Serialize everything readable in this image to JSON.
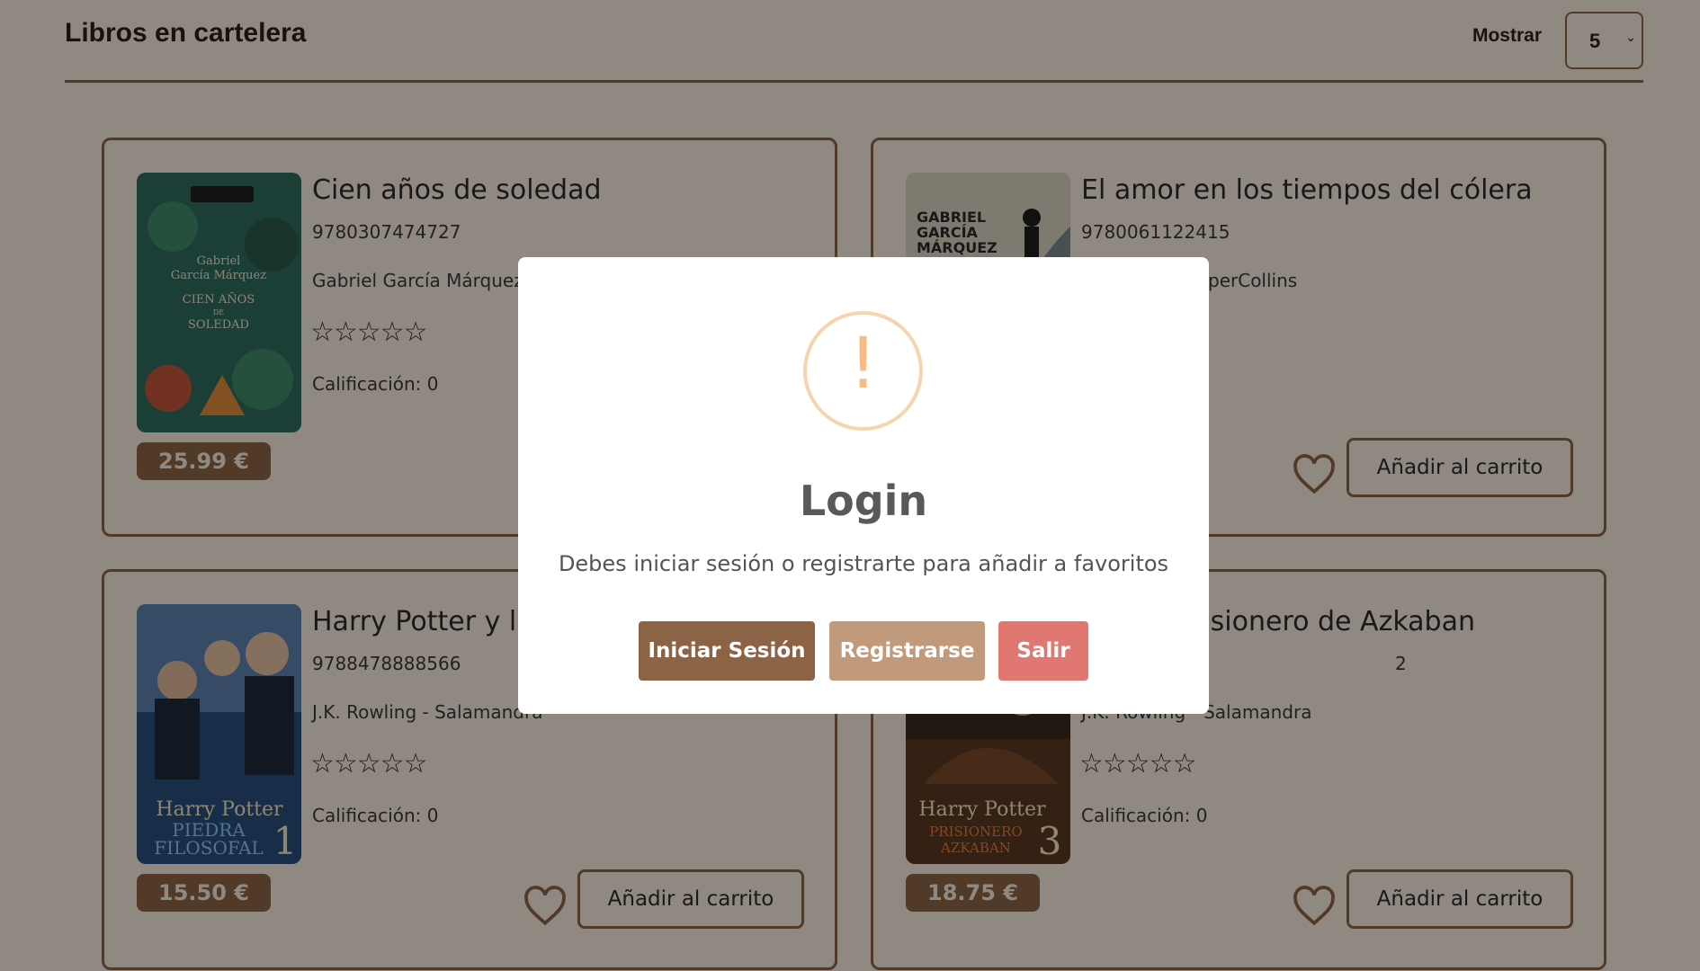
{
  "header": {
    "title": "Libros en cartelera",
    "show_label": "Mostrar",
    "show_value": "5"
  },
  "books": [
    {
      "title": "Cien años de soledad",
      "isbn": "9780307474727",
      "author_publisher": "Gabriel García Márquez -",
      "stars": "☆☆☆☆☆",
      "rating": "Calificación: 0",
      "price": "25.99 €",
      "cart_label": "Añadir al carrito",
      "cover": {
        "bg": "#2f6b5e",
        "line1": "Gabriel",
        "line2": "García Márquez",
        "line3": "CIEN AÑOS",
        "line4": "DE",
        "line5": "SOLEDAD"
      }
    },
    {
      "title": "El amor en los tiempos del cólera",
      "isbn": "9780061122415",
      "author_publisher": "Márquez - HarperCollins",
      "stars": "",
      "rating": "",
      "price": "",
      "cart_label": "Añadir al carrito",
      "cover": {
        "bg": "#d9d2c2",
        "line1": "GABRIEL",
        "line2": "GARCÍA",
        "line3": "MÁRQUEZ"
      }
    },
    {
      "title": "Harry Potter y la",
      "isbn": "9788478888566",
      "author_publisher": "J.K. Rowling - Salamandra",
      "stars": "☆☆☆☆☆",
      "rating": "Calificación: 0",
      "price": "15.50 €",
      "cart_label": "Añadir al carrito",
      "cover": {
        "bg": "#2a4f7a",
        "line1": "Harry Potter",
        "line2": "PIEDRA",
        "line3": "FILOSOFAL",
        "num": "1"
      }
    },
    {
      "title": "er y el prisionero de Azkaban",
      "isbn": "2",
      "author_publisher": "J.K. Rowling - Salamandra",
      "stars": "☆☆☆☆☆",
      "rating": "Calificación: 0",
      "price": "18.75 €",
      "cart_label": "Añadir al carrito",
      "cover": {
        "bg": "#5a3a22",
        "line1": "Harry Potter",
        "line2": "PRISIONERO",
        "line3": "AZKABAN",
        "num": "3"
      }
    }
  ],
  "modal": {
    "icon": "!",
    "title": "Login",
    "message": "Debes iniciar sesión o registrarte para añadir a favoritos",
    "buttons": {
      "login": "Iniciar Sesión",
      "register": "Registrarse",
      "exit": "Salir"
    }
  },
  "colors": {
    "accent": "#8c6445",
    "background": "#f7ecde",
    "register": "#c09a7a",
    "exit": "#e07770",
    "warning_icon": "#f8bb86"
  }
}
